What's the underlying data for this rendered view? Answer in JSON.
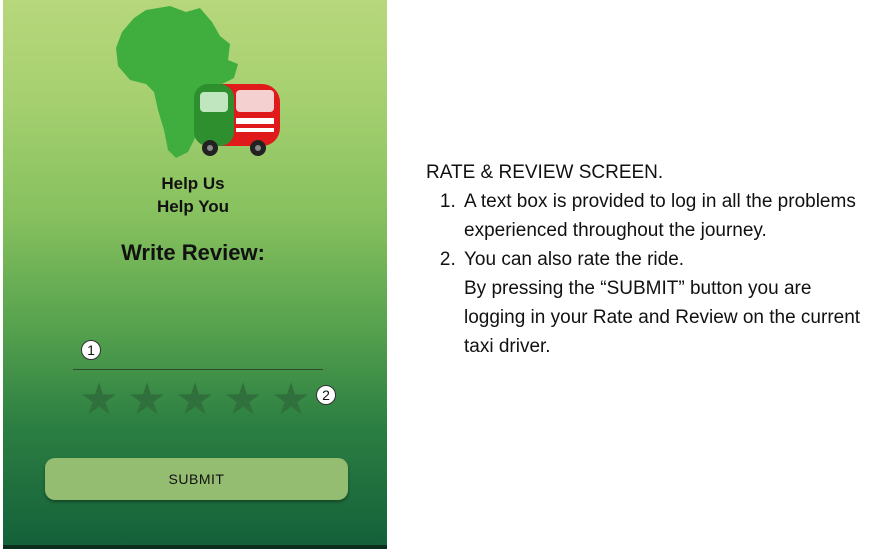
{
  "app": {
    "tagline_line1": "Help Us",
    "tagline_line2": "Help You",
    "heading": "Write Review:",
    "review_input": {
      "value": "",
      "placeholder": ""
    },
    "rating": {
      "max": 5,
      "value": 0
    },
    "submit_label": "SUBMIT",
    "markers": [
      "1",
      "2"
    ],
    "colors": {
      "gradient_top": "#b7d77c",
      "gradient_bottom": "#14613a",
      "star": "#2f6f3c",
      "submit_bg": "#94bd72",
      "logo_map": "#3fae3f",
      "logo_taxi": "#e01a1a"
    },
    "icons": [
      "africa-map-logo-icon",
      "taxi-logo-icon",
      "star-icon"
    ]
  },
  "notes": {
    "title": "RATE & REVIEW SCREEN.",
    "items": [
      {
        "lines": [
          "A text box is provided to log in all the problems experienced throughout the journey."
        ]
      },
      {
        "lines": [
          "You can also rate the ride.",
          "By pressing the “SUBMIT” button you are logging in your Rate and Review on the current taxi driver."
        ]
      }
    ]
  }
}
